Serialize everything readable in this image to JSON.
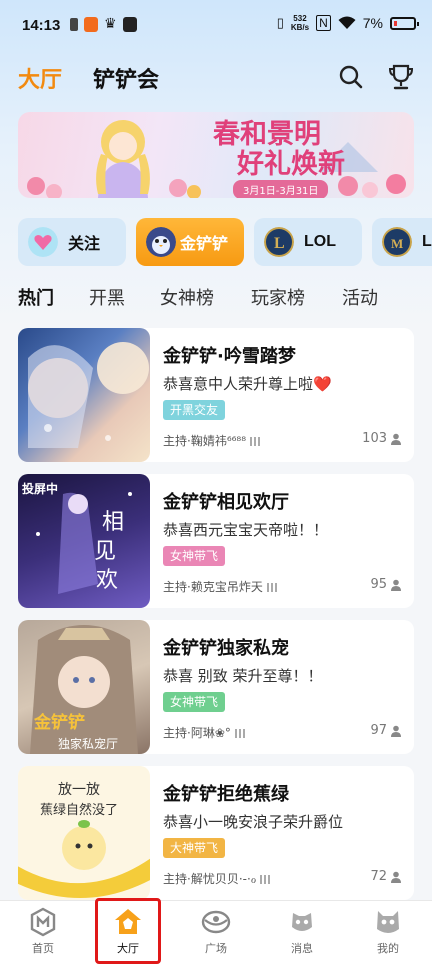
{
  "status_bar": {
    "time": "14:13",
    "net_speed_top": "532",
    "net_speed_bottom": "KB/s",
    "battery": "7%"
  },
  "header": {
    "tab_hall": "大厅",
    "tab_club": "铲铲会",
    "search_icon": "search-icon",
    "trophy_icon": "trophy-icon",
    "accent": "#f28a10"
  },
  "banner": {
    "title_line1": "春和景明",
    "title_line2": "好礼焕新",
    "date": "3月1日-3月31日"
  },
  "categories": [
    {
      "label": "关注",
      "icon": "heart-icon"
    },
    {
      "label": "金铲铲",
      "icon": "penguin-icon",
      "active": true
    },
    {
      "label": "LOL",
      "icon": "lol-icon"
    },
    {
      "label": "LO",
      "icon": "lol-m-icon"
    }
  ],
  "subtabs": [
    "热门",
    "开黑",
    "女神榜",
    "玩家榜",
    "活动"
  ],
  "rooms": [
    {
      "title": "金铲铲·吟雪踏梦",
      "subtitle": "恭喜意中人荣升尊上啦❤️",
      "tag": "开黑交友",
      "tag_color": "#5cc8d8",
      "tag_bg": "#dff4f7",
      "host": "主持·鞠婧祎⁶⁶⁸⁸",
      "count": "103"
    },
    {
      "title": "金铲铲相见欢厅",
      "subtitle": "恭喜西元宝宝天帝啦！！",
      "tag": "女神带飞",
      "tag_color": "#e0609a",
      "tag_bg": "#fbe2ee",
      "host": "主持·赖克宝吊炸天",
      "count": "95",
      "badge": "投屏中"
    },
    {
      "title": "金铲铲独家私宠",
      "subtitle": "恭喜 别致 荣升至尊！！",
      "tag": "女神带飞",
      "tag_color": "#3fb36a",
      "tag_bg": "#dcf3e4",
      "host": "主持·阿琳❀°",
      "count": "97"
    },
    {
      "title": "金铲铲拒绝蕉绿",
      "subtitle": "恭喜小一晚安浪子荣升爵位",
      "tag": "大神带飞",
      "tag_color": "#e89a20",
      "tag_bg": "#fdeccb",
      "host": "主持·解忧贝贝·-·ℴ",
      "count": "72"
    }
  ],
  "bottom_nav": [
    {
      "label": "首页",
      "icon": "home-icon"
    },
    {
      "label": "大厅",
      "icon": "hall-icon",
      "active": true
    },
    {
      "label": "广场",
      "icon": "plaza-icon"
    },
    {
      "label": "消息",
      "icon": "message-icon"
    },
    {
      "label": "我的",
      "icon": "profile-icon"
    }
  ]
}
